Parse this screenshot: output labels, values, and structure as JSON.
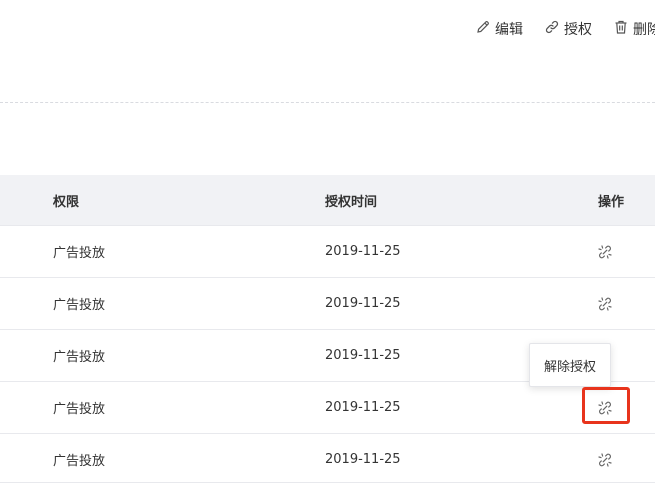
{
  "toolbar": {
    "edit_label": "编辑",
    "edit_icon": "pencil-icon",
    "authorize_label": "授权",
    "authorize_icon": "link-icon",
    "delete_label": "删除",
    "delete_icon": "trash-icon"
  },
  "table": {
    "headers": {
      "permission": "权限",
      "auth_time": "授权时间",
      "operation": "操作"
    },
    "rows": [
      {
        "permission": "广告投放",
        "auth_time": "2019-11-25",
        "action_icon": "unlink-icon"
      },
      {
        "permission": "广告投放",
        "auth_time": "2019-11-25",
        "action_icon": "unlink-icon"
      },
      {
        "permission": "广告投放",
        "auth_time": "2019-11-25",
        "action_icon": "unlink-icon"
      },
      {
        "permission": "广告投放",
        "auth_time": "2019-11-25",
        "action_icon": "unlink-icon"
      },
      {
        "permission": "广告投放",
        "auth_time": "2019-11-25",
        "action_icon": "unlink-icon"
      }
    ]
  },
  "tooltip": {
    "text": "解除授权"
  },
  "colors": {
    "highlight": "#e8341c",
    "header_bg": "#f1f2f5",
    "page_bg": "#f0f1f4"
  }
}
